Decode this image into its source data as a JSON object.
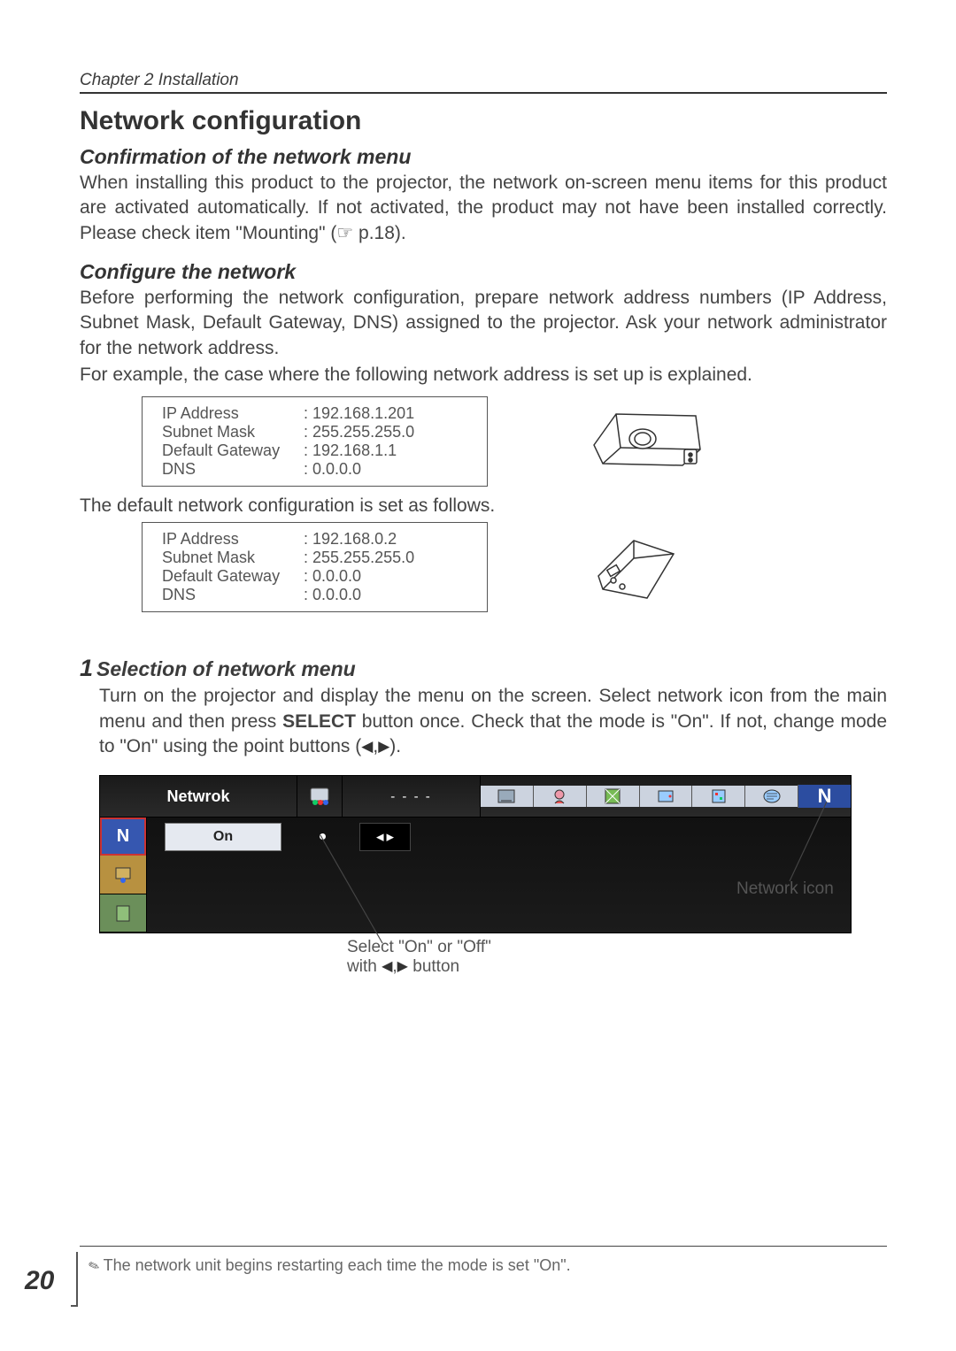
{
  "chapter": "Chapter 2 Installation",
  "section_title": "Network configuration",
  "sub1": {
    "heading": "Confirmation of the network menu",
    "text": "When installing this product to the projector, the network on-screen menu items for this product are activated automatically. If not activated, the product may not have been installed correctly. Please check item \"Mounting\" (☞ p.18)."
  },
  "sub2": {
    "heading": "Configure the network",
    "p1": "Before performing the network configuration, prepare network address numbers (IP Address, Subnet Mask, Default Gateway, DNS) assigned to the projector. Ask your network administrator for the network address.",
    "p2": "For example, the case where the following network address is set up is explained."
  },
  "net_example": {
    "ip_label": "IP Address",
    "ip_val": "192.168.1.201",
    "mask_label": "Subnet Mask",
    "mask_val": "255.255.255.0",
    "gw_label": "Default Gateway",
    "gw_val": "192.168.1.1",
    "dns_label": "DNS",
    "dns_val": "0.0.0.0"
  },
  "default_lead": "The default network configuration is set as follows.",
  "net_default": {
    "ip_label": "IP Address",
    "ip_val": "192.168.0.2",
    "mask_label": "Subnet Mask",
    "mask_val": "255.255.255.0",
    "gw_label": "Default Gateway",
    "gw_val": "0.0.0.0",
    "dns_label": "DNS",
    "dns_val": "0.0.0.0"
  },
  "step1": {
    "num": "1",
    "heading": "Selection of network menu",
    "body_a": "Turn on the projector and display the menu on the screen. Select network icon from the main menu and then press ",
    "body_select": "SELECT",
    "body_b": " button once. Check that the mode is \"On\". If not, change mode to \"On\" using the point buttons (",
    "body_c": ")."
  },
  "menu": {
    "title": "Netwrok",
    "dashes": "- - - -",
    "on_label": "On",
    "n_glyph": "N"
  },
  "annot": {
    "select_line1": "Select \"On\" or \"Off\"",
    "select_line2_a": "with ",
    "select_line2_b": " button",
    "network_icon": "Network icon"
  },
  "footnote": "The network unit begins restarting each time the mode is set \"On\".",
  "page_number": "20"
}
